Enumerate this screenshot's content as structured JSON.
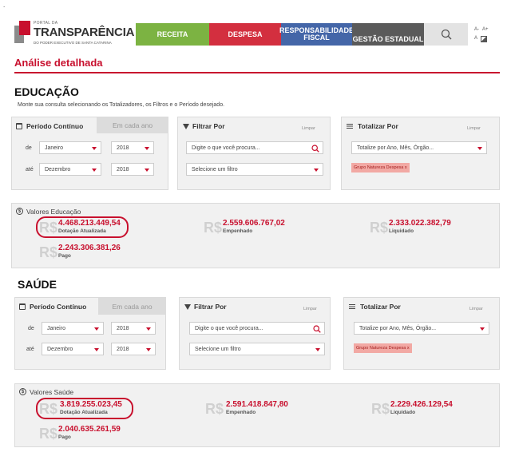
{
  "header": {
    "logo_small": "PORTAL DA",
    "logo_title": "TRANSPARÊNCIA",
    "logo_sub": "DO PODER EXECUTIVO DE SANTA CATARINA",
    "nav": {
      "receita": "RECEITA",
      "despesa": "DESPESA",
      "responsabilidade_l1": "RESPONSABILIDADE",
      "responsabilidade_l2": "FISCAL",
      "gestao": "GESTÃO ESTADUAL",
      "font_decrease": "A-",
      "font_increase": "A+",
      "font_contrast": "A"
    },
    "search_icon": "search-icon",
    "top_dot": "."
  },
  "page_title": "Análise detalhada",
  "sections": [
    {
      "title": "EDUCAÇÃO",
      "description": "Monte sua consulta selecionando os Totalizadores, os Filtros e o Período desejado.",
      "period": {
        "title": "Período Contínuo",
        "alt_tab": "Em cada ano",
        "from_label": "de",
        "to_label": "até",
        "from_month": "Janeiro",
        "from_year": "2018",
        "to_month": "Dezembro",
        "to_year": "2018"
      },
      "filter": {
        "title": "Filtrar Por",
        "clear": "Limpar",
        "search_placeholder": "Digite o que você procura...",
        "select_placeholder": "Selecione um filtro"
      },
      "totalize": {
        "title": "Totalizar Por",
        "clear": "Limpar",
        "select_value": "Totalize por Ano, Mês, Órgão...",
        "tag": "Grupo Natureza Despesa x"
      },
      "values": {
        "title": "Valores Educação",
        "currency": "R$",
        "items": [
          {
            "value": "4.468.213.449,54",
            "label": "Dotação Atualizada"
          },
          {
            "value": "2.559.606.767,02",
            "label": "Empenhado"
          },
          {
            "value": "2.333.022.382,79",
            "label": "Liquidado"
          },
          {
            "value": "2.243.306.381,26",
            "label": "Pago"
          }
        ]
      }
    },
    {
      "title": "SAÚDE",
      "period": {
        "title": "Período Contínuo",
        "alt_tab": "Em cada ano",
        "from_label": "de",
        "to_label": "até",
        "from_month": "Janeiro",
        "from_year": "2018",
        "to_month": "Dezembro",
        "to_year": "2018"
      },
      "filter": {
        "title": "Filtrar Por",
        "clear": "Limpar",
        "search_placeholder": "Digite o que você procura...",
        "select_placeholder": "Selecione um filtro"
      },
      "totalize": {
        "title": "Totalizar Por",
        "clear": "Limpar",
        "select_value": "Totalize por Ano, Mês, Órgão...",
        "tag": "Grupo Natureza Despesa x"
      },
      "values": {
        "title": "Valores Saúde",
        "currency": "R$",
        "items": [
          {
            "value": "3.819.255.023,45",
            "label": "Dotação Atualizada"
          },
          {
            "value": "2.591.418.847,80",
            "label": "Empenhado"
          },
          {
            "value": "2.229.426.129,54",
            "label": "Liquidado"
          },
          {
            "value": "2.040.635.261,59",
            "label": "Pago"
          }
        ]
      }
    }
  ],
  "colors": {
    "brand_red": "#c8102e",
    "receita_green": "#7cb342",
    "despesa_red": "#d32f3f",
    "resp_blue": "#4466a8",
    "gestao_gray": "#5a5a5a"
  }
}
